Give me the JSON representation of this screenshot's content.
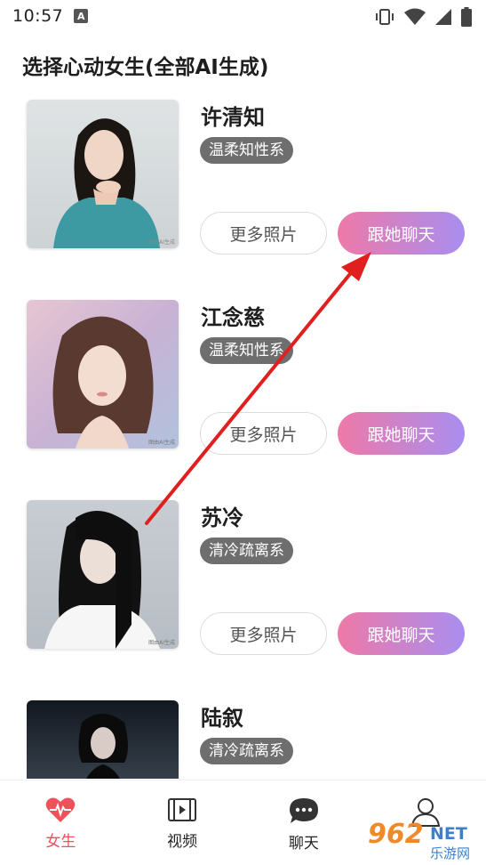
{
  "status": {
    "time": "10:57",
    "notif": "A"
  },
  "title": "选择心动女生(全部AI生成)",
  "profiles": [
    {
      "name": "许清知",
      "tag": "温柔知性系",
      "more": "更多照片",
      "chat": "跟她聊天",
      "watermark": "图由AI生成"
    },
    {
      "name": "江念慈",
      "tag": "温柔知性系",
      "more": "更多照片",
      "chat": "跟她聊天",
      "watermark": "图由AI生成"
    },
    {
      "name": "苏冷",
      "tag": "清冷疏离系",
      "more": "更多照片",
      "chat": "跟她聊天",
      "watermark": "图由AI生成"
    },
    {
      "name": "陆叙",
      "tag": "清冷疏离系"
    }
  ],
  "nav": [
    {
      "label": "女生",
      "icon": "heart-pulse-icon"
    },
    {
      "label": "视频",
      "icon": "film-icon"
    },
    {
      "label": "聊天",
      "icon": "chat-bubble-icon"
    },
    {
      "label": "",
      "icon": "person-icon"
    }
  ],
  "watermark": {
    "brand": "962",
    "suffix": "NET",
    "sub": "乐游网"
  },
  "colors": {
    "accent": "#f0505a",
    "chat_gradient_start": "#ee79a8",
    "chat_gradient_end": "#a88ef0",
    "tag_bg": "#6e6e6e",
    "arrow": "#e0201e"
  }
}
